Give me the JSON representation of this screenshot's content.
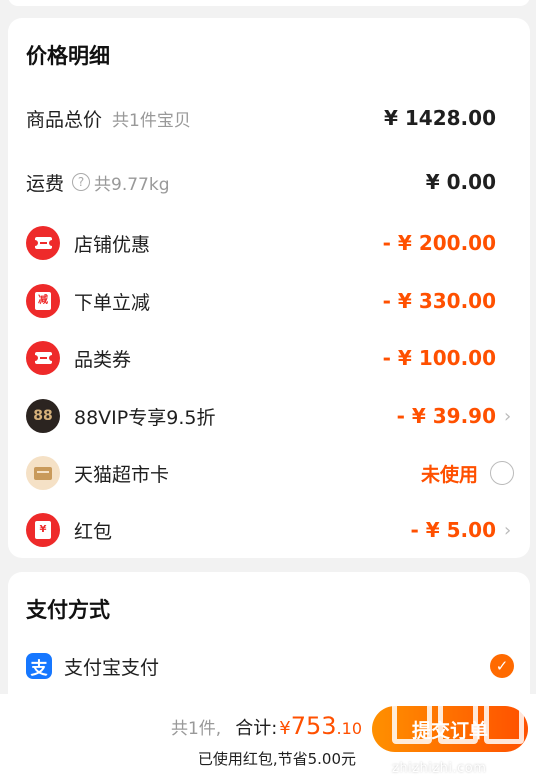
{
  "price_details": {
    "title": "价格明细",
    "goods_total": {
      "label": "商品总价",
      "sub": "共1件宝贝",
      "amount": "¥ 1428.00"
    },
    "shipping": {
      "label": "运费",
      "sub": "共9.77kg",
      "amount": "¥ 0.00"
    },
    "discounts": [
      {
        "label": "店铺优惠",
        "amount": "- ¥ 200.00",
        "icon": "ticket-icon"
      },
      {
        "label": "下单立减",
        "amount": "- ¥ 330.00",
        "icon": "reduce-icon",
        "icon_glyph": "减"
      },
      {
        "label": "品类券",
        "amount": "- ¥ 100.00",
        "icon": "ticket-icon"
      },
      {
        "label": "88VIP专享9.5折",
        "amount": "- ¥ 39.90",
        "icon": "88vip-icon",
        "icon_glyph": "88"
      },
      {
        "label": "天猫超市卡",
        "amount": "未使用",
        "icon": "card-icon"
      },
      {
        "label": "红包",
        "amount": "- ¥ 5.00",
        "icon": "red-packet-icon",
        "icon_glyph": "¥"
      }
    ]
  },
  "payment": {
    "title": "支付方式",
    "method": {
      "label": "支付宝支付",
      "icon_glyph": "支",
      "selected": true
    }
  },
  "bottom": {
    "count": "共1件,",
    "total_label": "合计:",
    "currency": "¥",
    "total_int": "753",
    "total_dec": ".10",
    "note": "已使用红包,节省5.00元",
    "submit": "提交订单"
  },
  "watermark": "zhizhizhi.com",
  "colors": {
    "accent": "#ff5000",
    "alipay": "#1677ff",
    "icon_red": "#ee2a2a"
  }
}
